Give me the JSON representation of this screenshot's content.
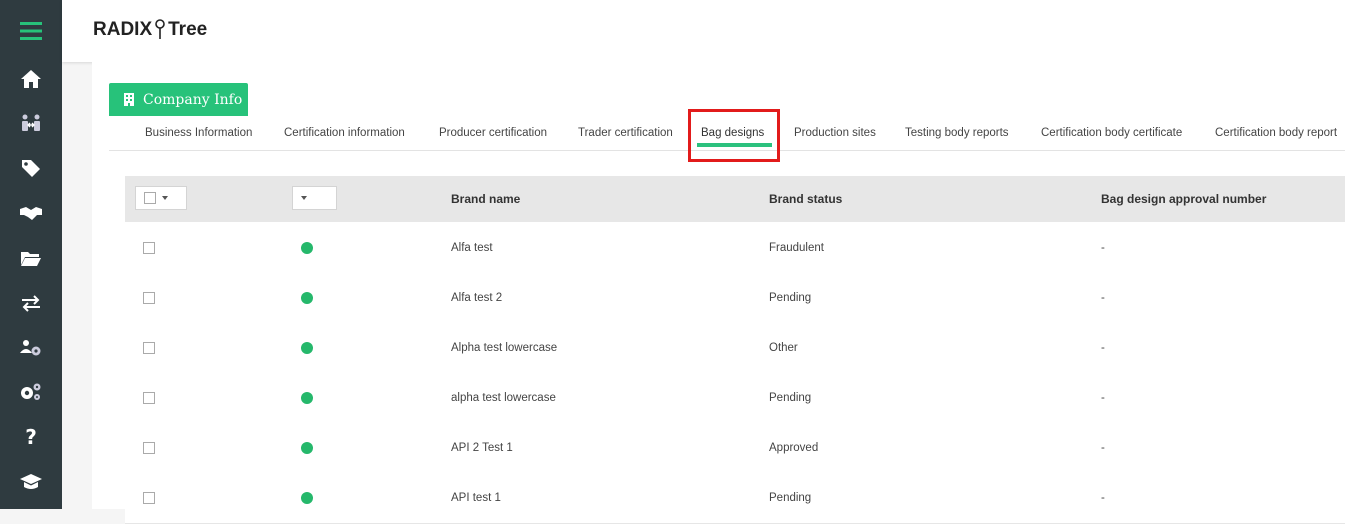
{
  "app": {
    "brand_left": "RADIX",
    "brand_right": "Tree",
    "accent_color": "#27c27a",
    "highlight_color": "#e21b1b"
  },
  "sidebar": {
    "items": [
      {
        "icon": "home-icon"
      },
      {
        "icon": "transport-icon"
      },
      {
        "icon": "tags-icon"
      },
      {
        "icon": "handshake-icon"
      },
      {
        "icon": "folder-icon"
      },
      {
        "icon": "exchange-icon"
      },
      {
        "icon": "users-settings-icon"
      },
      {
        "icon": "gears-icon"
      },
      {
        "icon": "help-icon"
      },
      {
        "icon": "graduation-cap-icon"
      }
    ]
  },
  "company_tab": {
    "label": "Company Info",
    "icon": "building-icon"
  },
  "subtabs": [
    {
      "label": "Business Information"
    },
    {
      "label": "Certification information"
    },
    {
      "label": "Producer certification"
    },
    {
      "label": "Trader certification"
    },
    {
      "label": "Bag designs",
      "active": true
    },
    {
      "label": "Production sites"
    },
    {
      "label": "Testing body reports"
    },
    {
      "label": "Certification body certificate"
    },
    {
      "label": "Certification body report"
    }
  ],
  "table": {
    "columns": [
      "Brand name",
      "Brand status",
      "Bag design approval number"
    ],
    "rows": [
      {
        "brand_name": "Alfa test",
        "status": "Fraudulent",
        "approval": "-"
      },
      {
        "brand_name": "Alfa test 2",
        "status": "Pending",
        "approval": "-"
      },
      {
        "brand_name": "Alpha test lowercase",
        "status": "Other",
        "approval": "-"
      },
      {
        "brand_name": "alpha test lowercase",
        "status": "Pending",
        "approval": "-"
      },
      {
        "brand_name": "API 2 Test 1",
        "status": "Approved",
        "approval": "-"
      },
      {
        "brand_name": "API test 1",
        "status": "Pending",
        "approval": "-"
      }
    ]
  }
}
